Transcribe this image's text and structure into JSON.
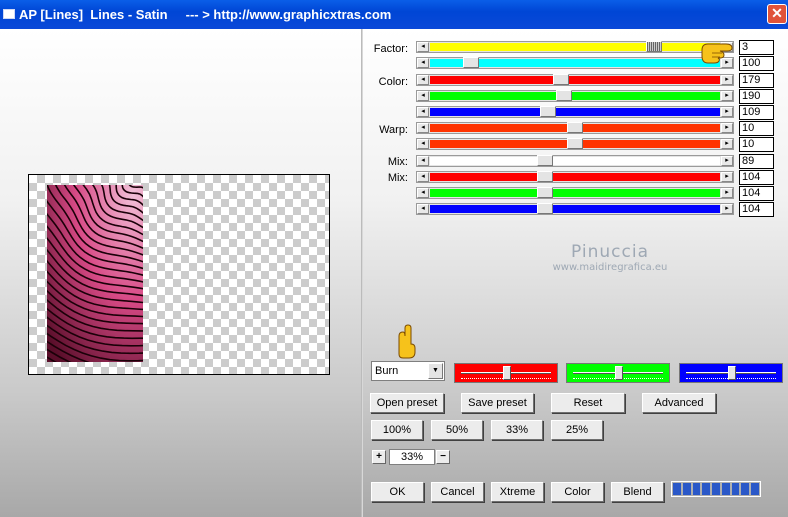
{
  "window": {
    "title": "AP [Lines]  Lines - Satin     --- > http://www.graphicxtras.com",
    "close_label": "✕"
  },
  "labels": {
    "factor": "Factor:",
    "color": "Color:",
    "warp": "Warp:",
    "mix1": "Mix:",
    "mix2": "Mix:"
  },
  "sliders": [
    {
      "id": "factor",
      "track": "#ffff00",
      "value": "3",
      "level": 0.79
    },
    {
      "id": "factor2",
      "track": "#00ffff",
      "value": "100",
      "level": 0.12
    },
    {
      "id": "color-r",
      "track": "#ff0000",
      "value": "179",
      "level": 0.45
    },
    {
      "id": "color-g",
      "track": "#00ff00",
      "value": "190",
      "level": 0.46
    },
    {
      "id": "color-b",
      "track": "#0000ff",
      "value": "109",
      "level": 0.4
    },
    {
      "id": "warp1",
      "track": "#ff3300",
      "value": "10",
      "level": 0.5
    },
    {
      "id": "warp2",
      "track": "#ff3300",
      "value": "10",
      "level": 0.5
    },
    {
      "id": "mix-w",
      "track": "#ffffff",
      "value": "89",
      "level": 0.39
    },
    {
      "id": "mix-r",
      "track": "#ff0000",
      "value": "104",
      "level": 0.39
    },
    {
      "id": "mix-g",
      "track": "#00ff00",
      "value": "104",
      "level": 0.39
    },
    {
      "id": "mix-b",
      "track": "#0000ff",
      "value": "104",
      "level": 0.39
    }
  ],
  "watermark": {
    "line1": "Pinuccia",
    "line2": "www.maidiregrafica.eu"
  },
  "blend_mode": {
    "selected": "Burn"
  },
  "color_channels": [
    {
      "name": "red",
      "color": "#ff0000",
      "level": 0.5
    },
    {
      "name": "green",
      "color": "#00ff00",
      "level": 0.5
    },
    {
      "name": "blue",
      "color": "#0000ff",
      "level": 0.5
    }
  ],
  "buttons": {
    "open_preset": "Open preset",
    "save_preset": "Save preset",
    "reset": "Reset",
    "advanced": "Advanced",
    "z100": "100%",
    "z50": "50%",
    "z33": "33%",
    "z25": "25%",
    "ok": "OK",
    "cancel": "Cancel",
    "xtreme": "Xtreme",
    "color": "Color",
    "blend": "Blend"
  },
  "zoom": {
    "plus": "+",
    "minus": "−",
    "value": "33%"
  },
  "progress": {
    "segments": 9,
    "level": 1.0
  },
  "icons": [
    "window-app-icon",
    "close-icon",
    "pointing-hand-icon"
  ]
}
